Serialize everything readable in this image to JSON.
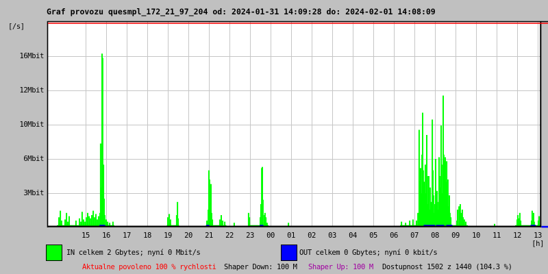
{
  "title": "Graf provozu quesmpl_172_21_97_204 od: 2024-01-31 14:09:28 do: 2024-02-01 14:08:09",
  "y_axis": {
    "unit_label": "[/s]",
    "ticks": [
      {
        "label": "16Mbit",
        "value": 16
      },
      {
        "label": "12Mbit",
        "value": 12
      },
      {
        "label": "10Mbit",
        "value": 10
      },
      {
        "label": "6Mbit",
        "value": 6
      },
      {
        "label": "3Mbit",
        "value": 3
      }
    ]
  },
  "x_axis": {
    "unit_label": "[h]",
    "labels": [
      "15",
      "16",
      "17",
      "18",
      "19",
      "20",
      "21",
      "22",
      "23",
      "00",
      "01",
      "02",
      "03",
      "04",
      "05",
      "06",
      "07",
      "08",
      "09",
      "10",
      "11",
      "12",
      "13"
    ]
  },
  "legend": {
    "in": {
      "color": "#00ff00",
      "label": "IN celkem 2 Gbytes; nyní 0 Mbit/s"
    },
    "out": {
      "color": "#0000ff",
      "label": "OUT celkem 0 Gbytes; nyní 0 kbit/s"
    }
  },
  "status": {
    "allowed": {
      "text": "Aktualne povoleno 100 % rychlosti",
      "color": "#ff0000"
    },
    "shaper_down": {
      "text": "Shaper Down: 100 M",
      "color": "#000000"
    },
    "shaper_up": {
      "text": "Shaper Up: 100 M",
      "color": "#a000a0"
    },
    "availability": {
      "text": "Dostupnost 1502 z 1440 (104.3 %)",
      "color": "#000000"
    }
  },
  "colors": {
    "page_background": "#c0c0c0",
    "plot_background": "#ffffff",
    "grid": "#c6c6c6",
    "border": "#000000",
    "in_series": "#00ff00",
    "out_series": "#0000ff",
    "limit_line": "#ff0000"
  },
  "chart_data": {
    "type": "area",
    "title": "Graf provozu quesmpl_172_21_97_204",
    "time_range": {
      "from": "2024-01-31 14:09:28",
      "to": "2024-02-01 14:08:09"
    },
    "x_unit": "hours (h>=24 means next day)",
    "y_unit": "Mbit/s",
    "y_tick_values": [
      3,
      6,
      10,
      12,
      16
    ],
    "limit_line": {
      "color": "#ff0000",
      "position": "top",
      "meaning": "Aktualne povoleno 100 % rychlosti"
    },
    "series": [
      {
        "name": "IN",
        "color": "#00ff00",
        "points": [
          [
            13.7,
            0.8
          ],
          [
            13.77,
            1.4
          ],
          [
            13.83,
            0.5
          ],
          [
            14.0,
            0.6
          ],
          [
            14.07,
            1.2
          ],
          [
            14.13,
            0.4
          ],
          [
            14.2,
            0.9
          ],
          [
            14.53,
            0.5
          ],
          [
            14.7,
            0.7
          ],
          [
            14.77,
            0.4
          ],
          [
            14.83,
            1.3
          ],
          [
            14.9,
            0.6
          ],
          [
            14.97,
            0.4
          ],
          [
            15.03,
            0.8
          ],
          [
            15.1,
            1.2
          ],
          [
            15.17,
            0.9
          ],
          [
            15.23,
            0.7
          ],
          [
            15.3,
            1.0
          ],
          [
            15.37,
            1.4
          ],
          [
            15.43,
            0.8
          ],
          [
            15.5,
            1.1
          ],
          [
            15.57,
            0.6
          ],
          [
            15.63,
            0.9
          ],
          [
            15.7,
            1.2
          ],
          [
            15.73,
            7.8
          ],
          [
            15.77,
            3.5
          ],
          [
            15.8,
            16.3
          ],
          [
            15.83,
            15.8
          ],
          [
            15.87,
            5.5
          ],
          [
            15.9,
            2.5
          ],
          [
            15.93,
            1.0
          ],
          [
            16.0,
            0.6
          ],
          [
            16.07,
            0.4
          ],
          [
            16.17,
            0.3
          ],
          [
            16.33,
            0.4
          ],
          [
            19.0,
            0.8
          ],
          [
            19.07,
            1.1
          ],
          [
            19.13,
            0.6
          ],
          [
            19.43,
            1.0
          ],
          [
            19.47,
            2.2
          ],
          [
            19.5,
            0.7
          ],
          [
            20.9,
            0.5
          ],
          [
            20.97,
            1.5
          ],
          [
            21.0,
            5.0
          ],
          [
            21.03,
            4.2
          ],
          [
            21.07,
            2.0
          ],
          [
            21.1,
            3.8
          ],
          [
            21.13,
            1.2
          ],
          [
            21.17,
            0.6
          ],
          [
            21.53,
            0.6
          ],
          [
            21.6,
            1.0
          ],
          [
            21.67,
            0.5
          ],
          [
            21.77,
            0.4
          ],
          [
            22.23,
            0.3
          ],
          [
            22.93,
            1.2
          ],
          [
            22.97,
            0.8
          ],
          [
            23.5,
            0.8
          ],
          [
            23.53,
            2.0
          ],
          [
            23.57,
            5.2
          ],
          [
            23.6,
            5.3
          ],
          [
            23.63,
            2.4
          ],
          [
            23.7,
            1.0
          ],
          [
            23.73,
            1.2
          ],
          [
            23.77,
            0.8
          ],
          [
            23.83,
            0.3
          ],
          [
            24.87,
            0.3
          ],
          [
            30.37,
            0.4
          ],
          [
            30.57,
            0.3
          ],
          [
            30.77,
            0.5
          ],
          [
            30.93,
            0.6
          ],
          [
            31.1,
            0.5
          ],
          [
            31.17,
            1.2
          ],
          [
            31.23,
            9.4
          ],
          [
            31.27,
            4.0
          ],
          [
            31.3,
            5.2
          ],
          [
            31.33,
            3.0
          ],
          [
            31.37,
            6.5
          ],
          [
            31.4,
            10.7
          ],
          [
            31.43,
            5.0
          ],
          [
            31.47,
            4.0
          ],
          [
            31.5,
            2.5
          ],
          [
            31.53,
            5.5
          ],
          [
            31.57,
            3.0
          ],
          [
            31.6,
            8.8
          ],
          [
            31.63,
            4.5
          ],
          [
            31.67,
            2.0
          ],
          [
            31.7,
            4.5
          ],
          [
            31.73,
            1.5
          ],
          [
            31.77,
            3.5
          ],
          [
            31.8,
            2.0
          ],
          [
            31.83,
            2.2
          ],
          [
            31.87,
            10.3
          ],
          [
            31.9,
            5.0
          ],
          [
            31.93,
            2.8
          ],
          [
            31.97,
            1.2
          ],
          [
            32.0,
            2.0
          ],
          [
            32.03,
            6.0
          ],
          [
            32.07,
            3.0
          ],
          [
            32.1,
            3.2
          ],
          [
            32.13,
            1.5
          ],
          [
            32.17,
            2.2
          ],
          [
            32.2,
            6.2
          ],
          [
            32.23,
            3.5
          ],
          [
            32.27,
            4.5
          ],
          [
            32.3,
            9.9
          ],
          [
            32.33,
            5.5
          ],
          [
            32.37,
            3.0
          ],
          [
            32.4,
            11.7
          ],
          [
            32.43,
            6.5
          ],
          [
            32.47,
            5.8
          ],
          [
            32.5,
            6.2
          ],
          [
            32.53,
            4.0
          ],
          [
            32.57,
            5.8
          ],
          [
            32.6,
            2.5
          ],
          [
            32.63,
            4.2
          ],
          [
            32.67,
            1.8
          ],
          [
            32.7,
            2.8
          ],
          [
            32.73,
            1.2
          ],
          [
            32.77,
            0.8
          ],
          [
            33.07,
            0.5
          ],
          [
            33.1,
            1.5
          ],
          [
            33.17,
            1.8
          ],
          [
            33.2,
            1.0
          ],
          [
            33.23,
            2.0
          ],
          [
            33.27,
            1.2
          ],
          [
            33.33,
            1.5
          ],
          [
            33.37,
            0.8
          ],
          [
            33.43,
            0.6
          ],
          [
            33.5,
            0.4
          ],
          [
            34.9,
            0.2
          ],
          [
            36.0,
            0.6
          ],
          [
            36.03,
            1.0
          ],
          [
            36.07,
            0.7
          ],
          [
            36.13,
            1.2
          ],
          [
            36.17,
            0.5
          ],
          [
            36.7,
            0.5
          ],
          [
            36.73,
            1.4
          ],
          [
            36.77,
            0.8
          ],
          [
            36.8,
            1.2
          ],
          [
            36.83,
            0.4
          ],
          [
            37.03,
            0.5
          ],
          [
            37.07,
            0.9
          ]
        ],
        "base_segments": [
          [
            13.6,
            16.4
          ],
          [
            18.95,
            19.55
          ],
          [
            20.85,
            21.85
          ],
          [
            22.9,
            23.9
          ],
          [
            30.3,
            33.6
          ],
          [
            35.9,
            37.15
          ]
        ]
      },
      {
        "name": "OUT",
        "color": "#0000ff",
        "points": [],
        "zero_segments": [
          [
            15.67,
            15.95
          ],
          [
            20.87,
            21.02
          ],
          [
            23.47,
            23.65
          ],
          [
            31.45,
            32.0
          ],
          [
            32.05,
            32.45
          ],
          [
            32.55,
            32.85
          ],
          [
            36.65,
            36.9
          ]
        ],
        "edge_marker": true
      }
    ]
  }
}
